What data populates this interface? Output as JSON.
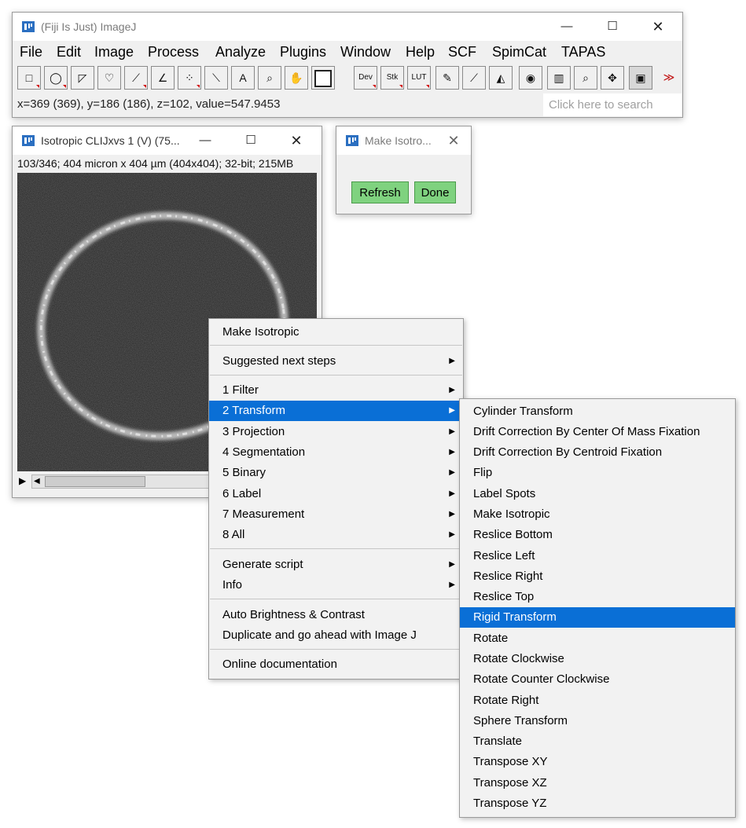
{
  "main_window": {
    "title": "(Fiji Is Just) ImageJ",
    "menu": [
      "File",
      "Edit",
      "Image",
      "Process",
      "Analyze",
      "Plugins",
      "Window",
      "Help",
      "SCF",
      "SpimCat",
      "TAPAS"
    ],
    "tools": [
      {
        "name": "rectangle-tool-icon",
        "glyph": "□"
      },
      {
        "name": "oval-tool-icon",
        "glyph": "◯"
      },
      {
        "name": "polygon-tool-icon",
        "glyph": "◸"
      },
      {
        "name": "freehand-tool-icon",
        "glyph": "♡"
      },
      {
        "name": "line-tool-icon",
        "glyph": "⟋"
      },
      {
        "name": "angle-tool-icon",
        "glyph": "∠"
      },
      {
        "name": "multipoint-tool-icon",
        "glyph": "⁘"
      },
      {
        "name": "wand-tool-icon",
        "glyph": "⟍"
      },
      {
        "name": "text-tool-icon",
        "glyph": "A"
      },
      {
        "name": "magnifier-tool-icon",
        "glyph": "⌕"
      },
      {
        "name": "hand-tool-icon",
        "glyph": "✋"
      },
      {
        "name": "color-picker-tool-icon",
        "glyph": "■"
      },
      {
        "name": "dev-tool",
        "glyph": "Dev"
      },
      {
        "name": "stk-tool",
        "glyph": "Stk"
      },
      {
        "name": "lut-tool",
        "glyph": "LUT"
      },
      {
        "name": "pencil-tool-icon",
        "glyph": "✎"
      },
      {
        "name": "brush-tool-icon",
        "glyph": "⟋"
      },
      {
        "name": "flood-fill-tool-icon",
        "glyph": "◭"
      },
      {
        "name": "camera-tool-icon",
        "glyph": "◉"
      },
      {
        "name": "lut-bar-tool-icon",
        "glyph": "▥"
      },
      {
        "name": "zoom-tool-icon",
        "glyph": "⌕"
      },
      {
        "name": "move-tool-icon",
        "glyph": "✥"
      },
      {
        "name": "overlay-tool-icon",
        "glyph": "▣"
      },
      {
        "name": "more-tools-icon",
        "glyph": "≫"
      }
    ],
    "status": "x=369 (369), y=186 (186), z=102, value=547.9453",
    "search_placeholder": "Click here to search"
  },
  "image_window": {
    "title": "Isotropic CLIJxvs 1 (V) (75...",
    "info": "103/346; 404 micron x 404 µm (404x404); 32-bit; 215MB"
  },
  "dialog": {
    "title": "Make Isotro...",
    "refresh": "Refresh",
    "done": "Done"
  },
  "context_menu": {
    "items": [
      {
        "label": "Make Isotropic",
        "arrow": false
      },
      {
        "label": "Suggested next steps",
        "arrow": true
      },
      {
        "label": "1 Filter",
        "arrow": true
      },
      {
        "label": "2 Transform",
        "arrow": true,
        "selected": true
      },
      {
        "label": "3 Projection",
        "arrow": true
      },
      {
        "label": "4 Segmentation",
        "arrow": true
      },
      {
        "label": "5 Binary",
        "arrow": true
      },
      {
        "label": "6 Label",
        "arrow": true
      },
      {
        "label": "7 Measurement",
        "arrow": true
      },
      {
        "label": "8 All",
        "arrow": true
      },
      {
        "label": "Generate script",
        "arrow": true
      },
      {
        "label": "Info",
        "arrow": true
      },
      {
        "label": "Auto Brightness & Contrast",
        "arrow": false
      },
      {
        "label": "Duplicate and go ahead with Image J",
        "arrow": false
      },
      {
        "label": "Online documentation",
        "arrow": false
      }
    ]
  },
  "submenu": {
    "items": [
      "Cylinder Transform",
      "Drift Correction By Center Of Mass Fixation",
      "Drift Correction By Centroid Fixation",
      "Flip",
      "Label Spots",
      "Make Isotropic",
      "Reslice Bottom",
      "Reslice Left",
      "Reslice Right",
      "Reslice Top",
      "Rigid Transform",
      "Rotate",
      "Rotate Clockwise",
      "Rotate Counter Clockwise",
      "Rotate Right",
      "Sphere Transform",
      "Translate",
      "Transpose XY",
      "Transpose XZ",
      "Transpose YZ"
    ],
    "selected": "Rigid Transform"
  },
  "colors": {
    "selection": "#0a6fd6",
    "button_green": "#7fd27f"
  }
}
